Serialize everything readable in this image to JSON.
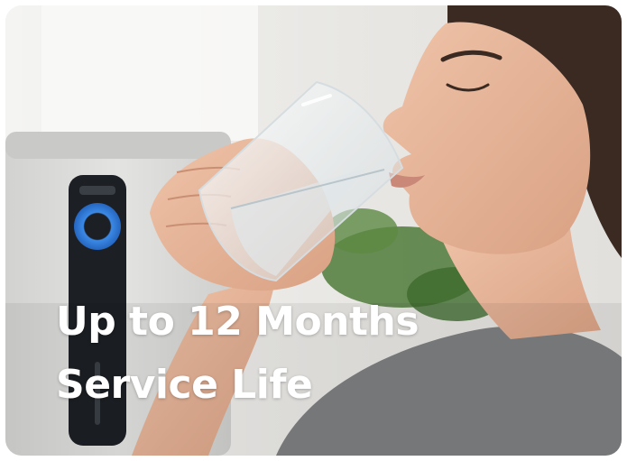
{
  "card": {
    "headline_line1": "Up to 12 Months",
    "headline_line2": "Service Life"
  },
  "photo": {
    "subject": "woman-drinking-water",
    "background_device": "water-purifier",
    "colors": {
      "background": "#eeedea",
      "skin": "#e6b59a",
      "shirt": "#7d7f80",
      "hair": "#3b2a22",
      "device_body": "#dadad8",
      "device_panel": "#1c1f24",
      "device_ring": "#2f7ad8",
      "plant": "#4f7a3a",
      "headline_text": "#ffffff"
    }
  }
}
